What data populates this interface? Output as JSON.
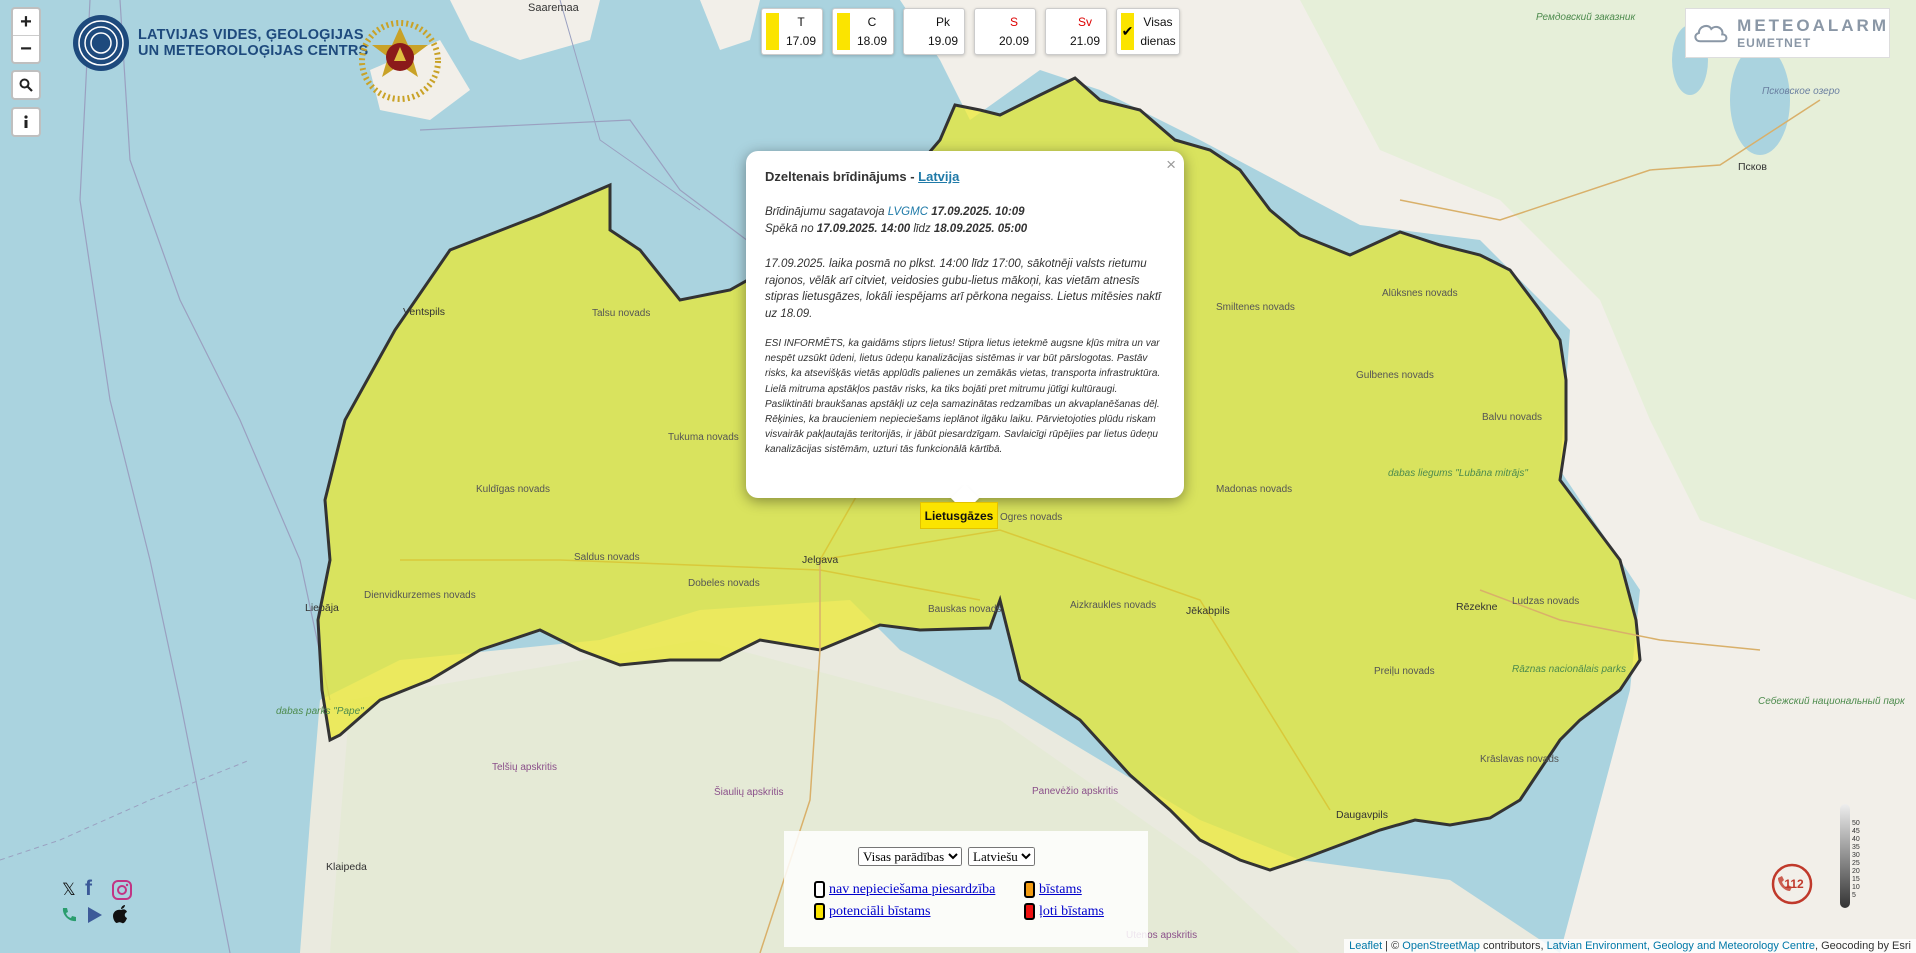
{
  "days": [
    {
      "name": "T",
      "date": "17.09",
      "color": "#fbe400",
      "name_red": false
    },
    {
      "name": "C",
      "date": "18.09",
      "color": "#fbe400",
      "name_red": false
    },
    {
      "name": "Pk",
      "date": "19.09",
      "color": "#ffffff",
      "name_red": false
    },
    {
      "name": "S",
      "date": "20.09",
      "color": "#ffffff",
      "name_red": true
    },
    {
      "name": "Sv",
      "date": "21.09",
      "color": "#ffffff",
      "name_red": true
    }
  ],
  "all_days": {
    "line1": "Visas",
    "line2": "dienas",
    "checked": true,
    "icon": "checkmark-icon"
  },
  "logo": {
    "line1": "LATVIJAS VIDES, ĢEOLOĢIJAS",
    "line2": "UN METEOROLOĢIJAS CENTRS"
  },
  "meteoalarm": {
    "line1": "METEOALARM",
    "line2": "EUMETNET"
  },
  "map_controls": {
    "zoom_in": "+",
    "zoom_out": "−"
  },
  "popup": {
    "close": "×",
    "title_prefix": "Dzeltenais brīdinājums - ",
    "title_link": "Latvija",
    "prepared_label": "Brīdinājumu sagatavoja ",
    "prepared_by": "LVGMC",
    "prepared_time": " 17.09.2025. 10:09",
    "valid_label": "Spēkā no ",
    "valid_from": "17.09.2025. 14:00",
    "valid_mid": " līdz ",
    "valid_to": "18.09.2025. 05:00",
    "description": "17.09.2025. laika posmā no plkst. 14:00 līdz 17:00, sākotnēji valsts rietumu rajonos, vēlāk arī citviet, veidosies gubu-lietus mākoņi, kas vietām atnesīs stipras lietusgāzes, lokāli iespējams arī pērkona negaiss. Lietus mitēsies naktī uz 18.09.",
    "info": "ESI INFORMĒTS, ka gaidāms stiprs lietus! Stipra lietus ietekmē augsne kļūs mitra un var nespēt uzsūkt ūdeni, lietus ūdeņu kanalizācijas sistēmas ir var būt pārslogotas. Pastāv risks, ka atsevišķās vietās applūdīs palienes un zemākās vietas, transporta infrastruktūra. Lielā mitruma apstākļos pastāv risks, ka tiks bojāti pret mitrumu jūtīgi kultūraugi. Pasliktināti braukšanas apstākļi uz ceļa samazinātas redzamības un akvaplanēšanas dēļ. Rēķinies, ka braucieniem nepieciešams ieplānot ilgāku laiku. Pārvietojoties plūdu riskam visvairāk pakļautajās teritorijās, ir jābūt piesardzīgam. Savlaicīgi rūpējies par lietus ūdeņu kanalizācijas sistēmām, uzturi tās funkcionālā kārtībā."
  },
  "marker": {
    "label": "Lietusgāzes",
    "color": "#fbe400"
  },
  "legend": {
    "phenomena_select": "Visas parādības",
    "language_select": "Latviešu",
    "items": [
      {
        "label": "nav nepieciešama piesardzība",
        "color": "#ffffff"
      },
      {
        "label": "bīstams",
        "color": "#f39c12"
      },
      {
        "label": "potenciāli bīstams",
        "color": "#fbe400"
      },
      {
        "label": "ļoti bīstams",
        "color": "#ee1111"
      }
    ]
  },
  "social": {
    "x_label": "𝕏",
    "facebook_label": "f"
  },
  "attribution": {
    "leaflet": "Leaflet",
    "sep1": " | © ",
    "osm": "OpenStreetMap",
    "sep2": " contributors, ",
    "lvgmc": "Latvian Environment, Geology and Meteorology Centre",
    "sep3": ", Geocoding by Esri"
  },
  "scale_ticks": [
    "50",
    "45",
    "40",
    "35",
    "30",
    "25",
    "20",
    "15",
    "10",
    "5"
  ],
  "map_labels": {
    "saaremaa": "Saaremaa",
    "ventspils": "Ventspils",
    "liepaja": "Liepāja",
    "jelgava": "Jelgava",
    "jekabpils": "Jēkabpils",
    "rezekne": "Rēzekne",
    "daugavpils": "Daugavpils",
    "pskov": "Псков",
    "klaipeda": "Klaipeda",
    "telsiu": "Telšių apskritis",
    "siauliu": "Šiaulių apskritis",
    "panevezio": "Panevėžio apskritis",
    "utenos": "Utenos apskritis",
    "kuldigas": "Kuldīgas novads",
    "saldus": "Saldus novads",
    "dobeles": "Dobeles novads",
    "tukuma": "Tukuma novads",
    "talsu": "Talsu novads",
    "madonas": "Madonas novads",
    "gulbenes": "Gulbenes novads",
    "aluksnes": "Alūksnes novads",
    "balvu": "Balvu novads",
    "ludzas": "Ludzas novads",
    "kraslavas": "Krāslavas novads",
    "preilu": "Preiļu novads",
    "aizkraukles": "Aizkraukles novads",
    "bauskas": "Bauskas novads",
    "ogres": "Ogres novads",
    "smiltenes": "Smiltenes novads",
    "dienvidkurzemes": "Dienvidkurzemes novads",
    "pskovskoe": "Псковское озеро",
    "sebezhsky": "Себежский национальный парк",
    "dabas_parks_pape": "dabas parks \"Pape\"",
    "lubans": "dabas liegums \"Lubāna mitrājs\"",
    "raznas": "Rāznas nacionālais parks",
    "remdovsky": "Ремдовский заказник"
  }
}
